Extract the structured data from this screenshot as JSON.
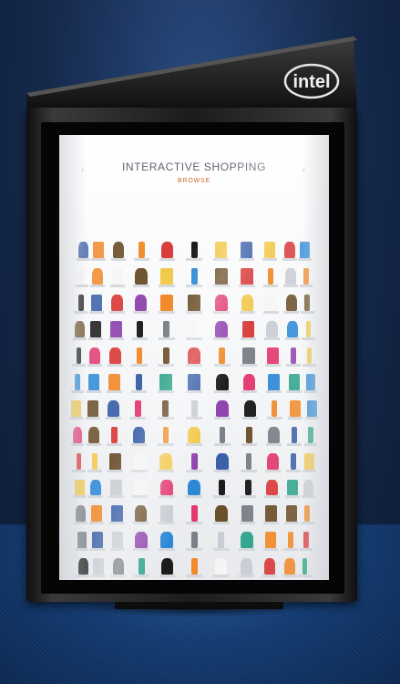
{
  "brand": {
    "logo_text": "intel"
  },
  "screen": {
    "title": "INTERACTIVE SHOPPING",
    "subtitle": "BROWSE",
    "nav_left": "›",
    "nav_right": "‹"
  },
  "catalog": {
    "rows": 13,
    "palette": [
      "#e23a6f",
      "#f08a2a",
      "#2c89d6",
      "#1a1a1a",
      "#c9ccd3",
      "#6b4f2a",
      "#3a5fa8",
      "#d93b3b",
      "#f2c94c",
      "#8e44ad",
      "#2ea38b",
      "#7a7f88",
      "#f5f5f5"
    ]
  }
}
